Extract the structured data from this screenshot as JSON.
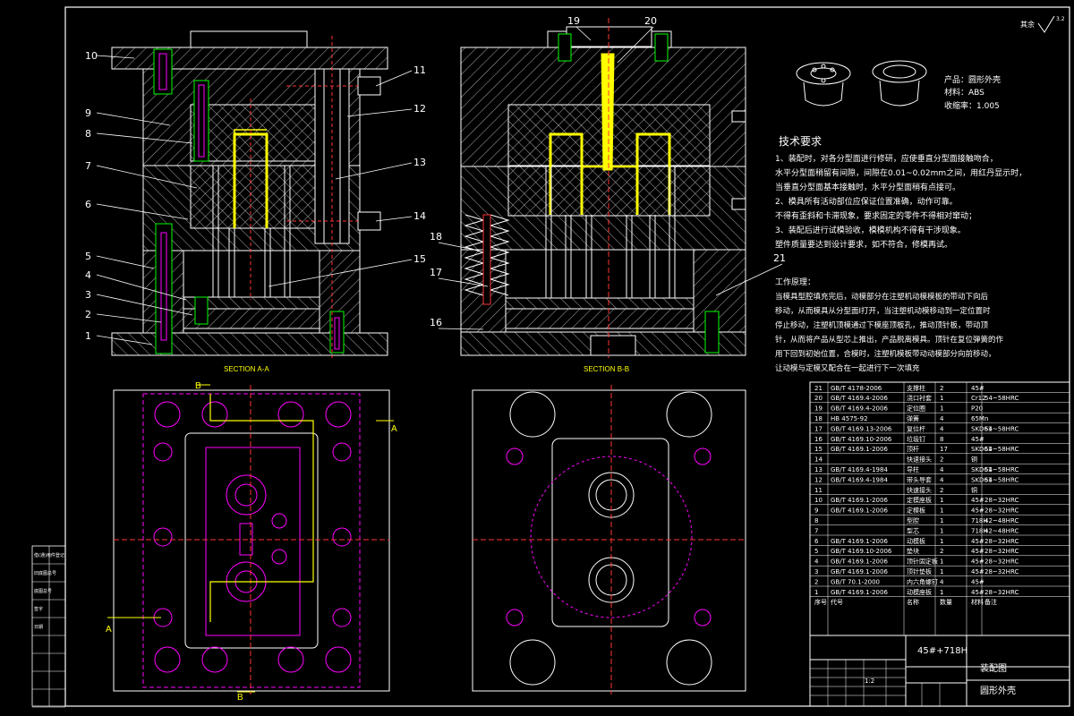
{
  "colors": {
    "background": "#000000",
    "outline": "#ffffff",
    "section": "#ffff00",
    "part": "#ff00ff",
    "centerline": "#ff3333",
    "hatch": "#c8c8c8"
  },
  "section_titles": [
    "SECTION A-A",
    "SECTION B-B"
  ],
  "section_markers": {
    "b_top": "B",
    "b_bottom": "B",
    "a_right": "A",
    "a_left": "A"
  },
  "callouts_left": [
    "10",
    "9",
    "8",
    "7",
    "6",
    "5",
    "4",
    "3",
    "2",
    "1"
  ],
  "callouts_right_a": [
    "11",
    "12",
    "13",
    "14",
    "15"
  ],
  "callouts_b": {
    "top_a": "19",
    "top_b": "20",
    "left_a": "18",
    "left_b": "17",
    "left_c": "16",
    "right": "21"
  },
  "roughness_label": "其余",
  "roughness_value": "3.2",
  "product": {
    "name": "产品：圆形外壳",
    "material": "材料：ABS",
    "shrinkage": "收缩率：1.005"
  },
  "tech_requirements": {
    "title": "技术要求",
    "lines": [
      "1、装配时，对各分型面进行修研，应使垂直分型面接触吻合，",
      "水平分型面稍留有间隙，间隙在0.01~0.02mm之间，用红丹显示时，",
      "当垂直分型面基本接触时，水平分型面稍有点接可。",
      "2、模具所有活动部位应保证位置准确，动作可靠。",
      "不得有歪斜和卡滞现象，要求固定的零件不得相对窜动；",
      "3、装配后进行试模验收，模模机构不得有干涉现象。",
      "塑件质量要达到设计要求，如不符合，修模再试。"
    ]
  },
  "work_principle": {
    "title": "工作原理：",
    "lines": [
      "当模具型腔填充完后，动模部分在注塑机动模模板的带动下向后",
      "移动，从而模具从分型面Ⅰ打开，当注塑机动模移动到一定位置时",
      "停止移动，注塑机顶模通过下模座顶板孔，推动顶针板，带动顶",
      "针，从而将产品从型芯上推出，产品脱离模具。顶针在复位弹簧的作",
      "用下回到初始位置，合模时，注塑机模板带动动模部分向前移动，",
      "让动模与定模又配合在一起进行下一次填充"
    ]
  },
  "bom_header": [
    "序号",
    "代号",
    "名称",
    "数量",
    "材料",
    "备注"
  ],
  "bom_rows": [
    [
      "21",
      "GB/T 4178-2006",
      "支撑柱",
      "45#",
      "2",
      ""
    ],
    [
      "20",
      "GB/T 4169.4-2006",
      "浇口衬套",
      "Cr12",
      "1",
      "54~58HRC"
    ],
    [
      "19",
      "GB/T 4169.4-2006",
      "定位圈",
      "P20",
      "1",
      ""
    ],
    [
      "18",
      "HB 4575-92",
      "弹簧",
      "65Mn",
      "4",
      ""
    ],
    [
      "17",
      "GB/T 4169.13-2006",
      "复位杆",
      "SKD61",
      "4",
      "54~58HRC"
    ],
    [
      "16",
      "GB/T 4169.10-2006",
      "垃圾钉",
      "45#",
      "8",
      ""
    ],
    [
      "15",
      "GB/T 4169.1-2006",
      "顶杆",
      "SKD61",
      "17",
      "54~58HRC"
    ],
    [
      "14",
      "",
      "快速接头",
      "铜",
      "2",
      ""
    ],
    [
      "13",
      "GB/T 4169.4-1984",
      "导柱",
      "SKD61",
      "4",
      "54~58HRC"
    ],
    [
      "12",
      "GB/T 4169.4-1984",
      "带头导套",
      "SKD61",
      "4",
      "54~58HRC"
    ],
    [
      "11",
      "",
      "快速接头",
      "铜",
      "2",
      ""
    ],
    [
      "10",
      "GB/T 4169.1-2006",
      "定模座板",
      "45#",
      "1",
      "28~32HRC"
    ],
    [
      "9",
      "GB/T 4169.1-2006",
      "定模板",
      "45#",
      "1",
      "28~32HRC"
    ],
    [
      "8",
      "",
      "型腔",
      "718H",
      "1",
      "42~48HRC"
    ],
    [
      "7",
      "",
      "型芯",
      "718H",
      "1",
      "42~48HRC"
    ],
    [
      "6",
      "GB/T 4169.1-2006",
      "动模板",
      "45#",
      "1",
      "28~32HRC"
    ],
    [
      "5",
      "GB/T 4169.10-2006",
      "垫块",
      "45#",
      "2",
      "28~32HRC"
    ],
    [
      "4",
      "GB/T 4169.1-2006",
      "顶针固定板",
      "45#",
      "1",
      "28~32HRC"
    ],
    [
      "3",
      "GB/T 4169.1-2006",
      "顶针垫板",
      "45#",
      "1",
      "28~32HRC"
    ],
    [
      "2",
      "GB/T 70.1-2000",
      "内六角螺钉",
      "45#",
      "4",
      ""
    ],
    [
      "1",
      "GB/T 4169.1-2006",
      "动模座板",
      "45#",
      "1",
      "28~32HRC"
    ]
  ],
  "title_block": {
    "material": "45#+718H",
    "drawing": "装配图",
    "part": "圆形外壳",
    "scale": "1:2"
  },
  "side_labels": [
    "借(通)用件登记",
    "旧底图总号",
    "底图总号",
    "签字",
    "日期",
    "",
    "",
    "",
    ""
  ]
}
